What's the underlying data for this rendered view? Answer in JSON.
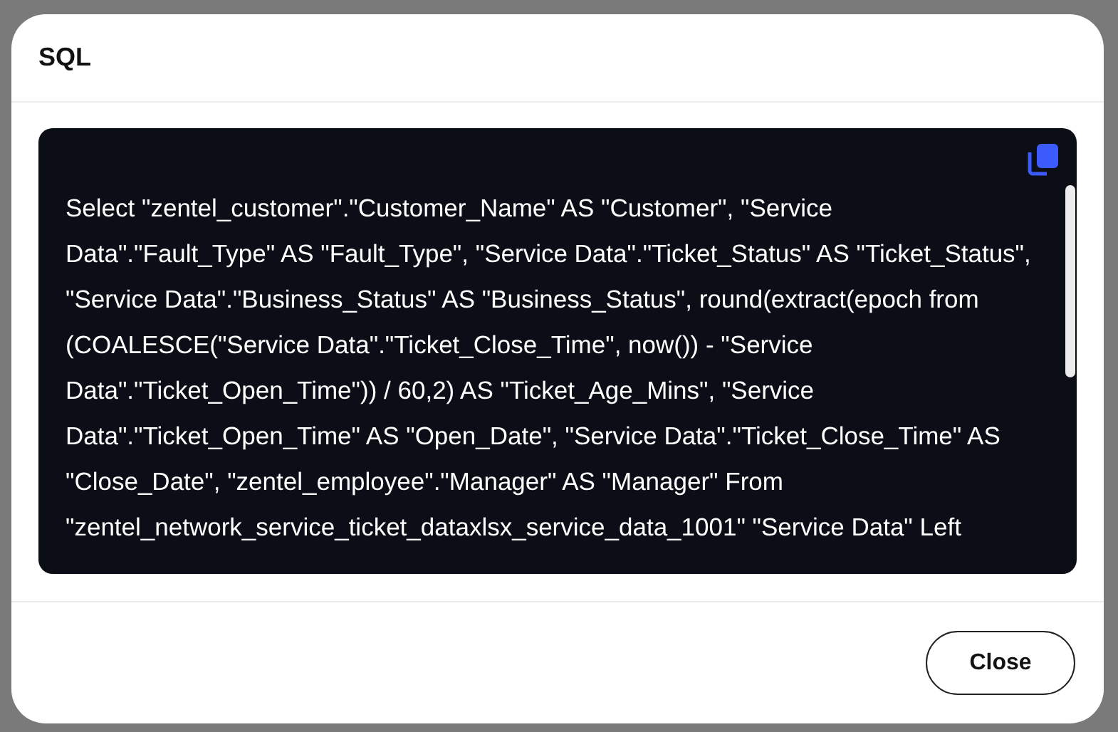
{
  "dialog": {
    "title": "SQL",
    "code": "Select \"zentel_customer\".\"Customer_Name\" AS \"Customer\", \"Service Data\".\"Fault_Type\" AS \"Fault_Type\", \"Service Data\".\"Ticket_Status\" AS \"Ticket_Status\", \"Service Data\".\"Business_Status\" AS \"Business_Status\", round(extract(epoch from (COALESCE(\"Service Data\".\"Ticket_Close_Time\", now()) - \"Service Data\".\"Ticket_Open_Time\")) / 60,2) AS \"Ticket_Age_Mins\", \"Service Data\".\"Ticket_Open_Time\" AS \"Open_Date\", \"Service Data\".\"Ticket_Close_Time\" AS \"Close_Date\", \"zentel_employee\".\"Manager\" AS \"Manager\" From \"zentel_network_service_ticket_dataxlsx_service_data_1001\" \"Service Data\" Left",
    "buttons": [
      "Close"
    ]
  }
}
